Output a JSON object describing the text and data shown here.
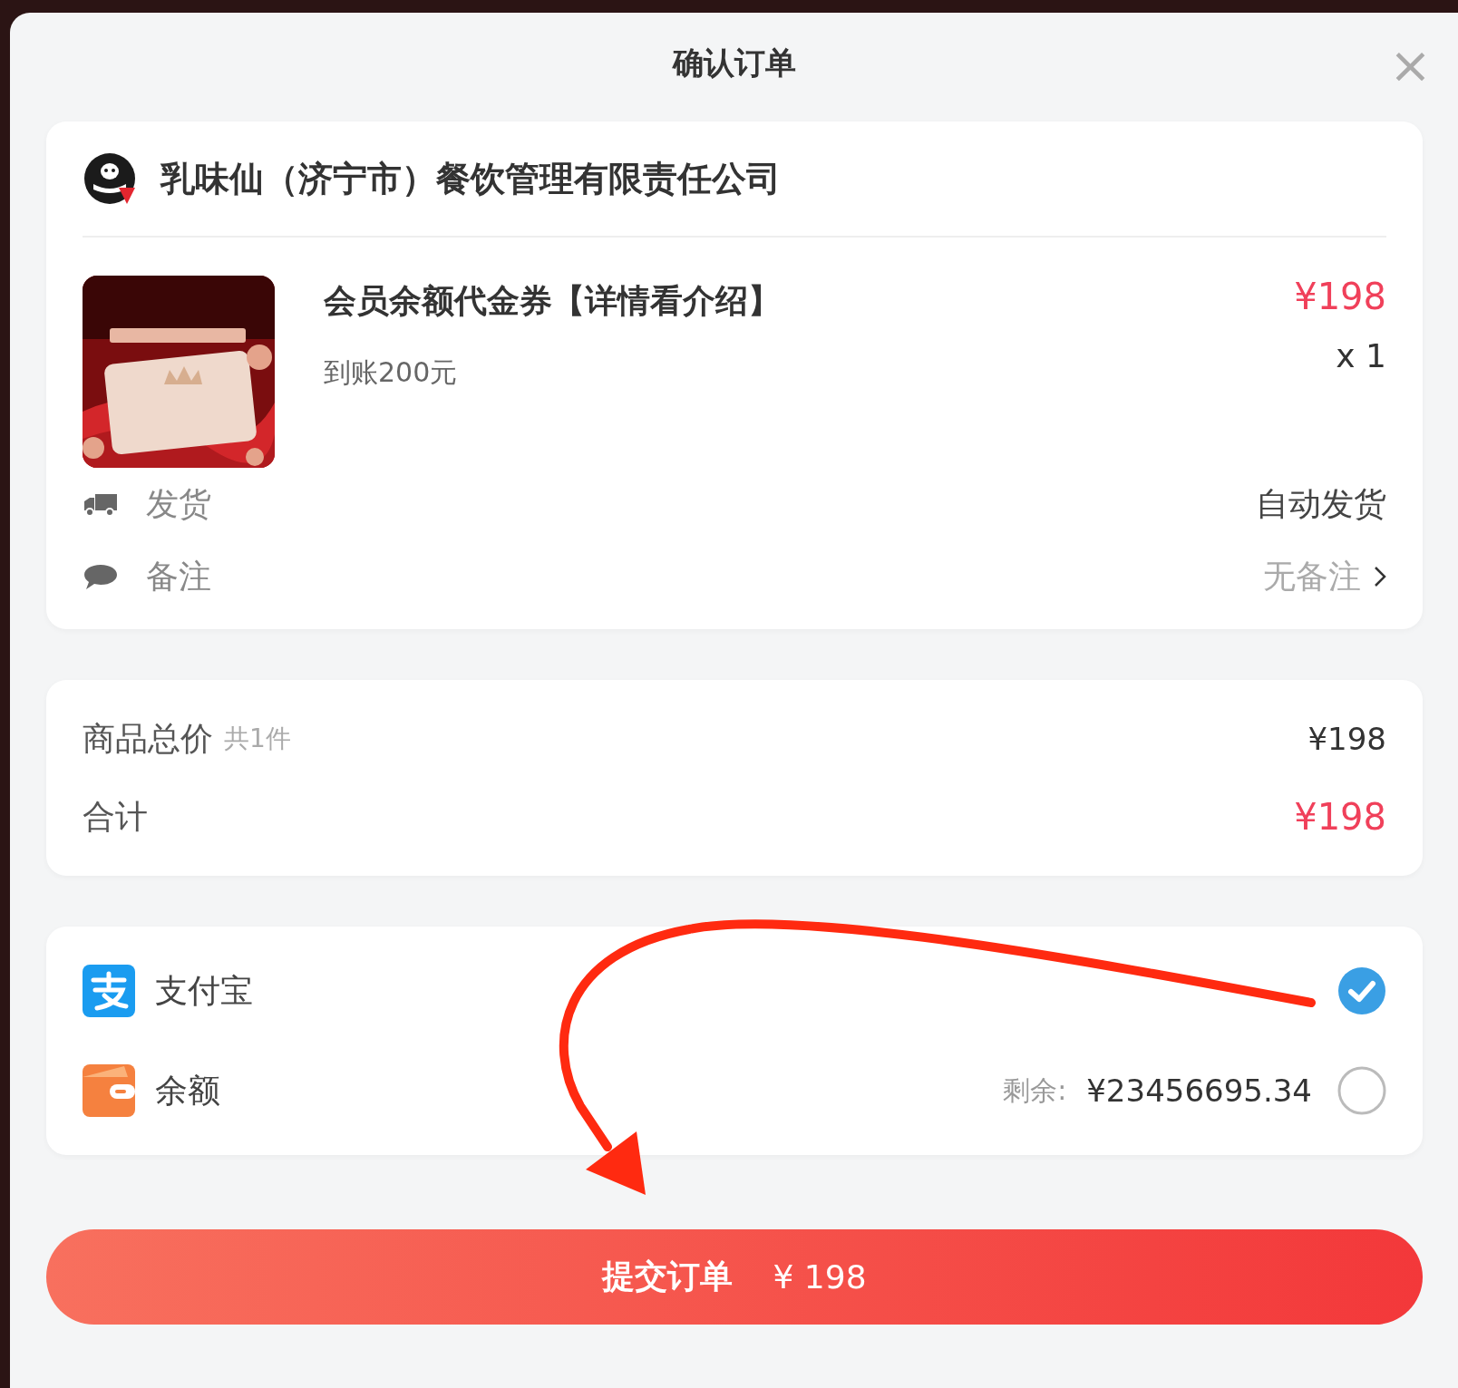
{
  "dialog": {
    "title": "确认订单",
    "close": "×"
  },
  "shop": {
    "name": "乳味仙（济宁市）餐饮管理有限责任公司"
  },
  "product": {
    "kind": "picture",
    "title": "会员余额代金券【详情看介绍】",
    "subtitle": "到账200元",
    "price": "¥198",
    "quantity": "x 1"
  },
  "info_rows": [
    {
      "kind": "delivery",
      "label": "发货",
      "value": "自动发货",
      "link": false
    },
    {
      "kind": "note",
      "label": "备注",
      "value": "无备注",
      "link": true
    }
  ],
  "summary": [
    {
      "label": "商品总价",
      "note": "共1件",
      "value": "¥198",
      "highlight": false
    },
    {
      "label": "合计",
      "value": "¥198",
      "highlight": true
    }
  ],
  "payment_methods": [
    {
      "kind": "alipay",
      "label": "支付宝",
      "selected": true
    },
    {
      "kind": "balance",
      "label": "余额",
      "balance_label": "剩余:",
      "balance": "¥23456695.34",
      "selected": false
    }
  ],
  "submit": {
    "label": "提交订单",
    "amount": "¥ 198"
  }
}
